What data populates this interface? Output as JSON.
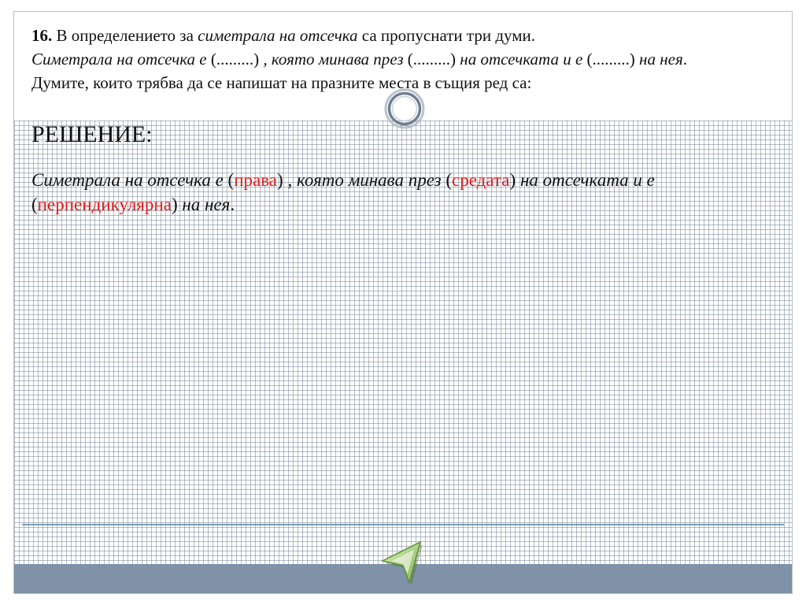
{
  "problem": {
    "number": "16.",
    "intro_before": "В определението за",
    "intro_term": "симетрала на отсечка",
    "intro_after": "са пропуснати три думи.",
    "sentence_part1": "Симетрала на отсечка е",
    "blank": "(.........)",
    "sentence_part2": ", която минава през",
    "sentence_part3": "на отсечката и е",
    "sentence_part4": "на нея",
    "period": ".",
    "instruction": "Думите, които трябва да се напишат на празните места в същия ред са:"
  },
  "solution": {
    "heading": "РЕШЕНИЕ:",
    "part1": "Симетрала на отсечка е",
    "open_paren": "(",
    "close_paren": ")",
    "answer1": "права",
    "part2": ", която минава през",
    "answer2": "средата",
    "part3": "на отсечката и е",
    "answer3": "перпендикулярна",
    "part4": "на нея",
    "period": "."
  },
  "icons": {
    "center_ring": "ring-icon",
    "back_arrow": "back-arrow-icon"
  },
  "colors": {
    "answer_text": "#e31b1b",
    "bottom_bar": "#7f92a8",
    "grid_line": "#76869a",
    "arrow_green": "#9fcf70"
  }
}
